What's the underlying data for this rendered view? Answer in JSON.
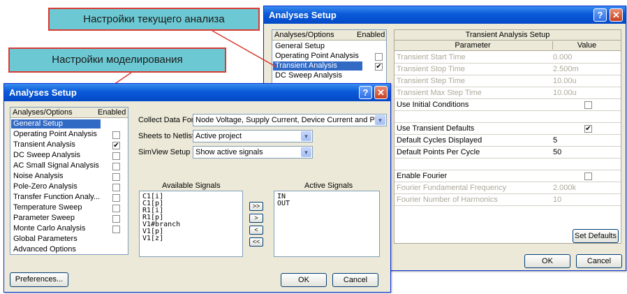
{
  "callouts": {
    "current_analysis": "Настройки текущего анализа",
    "simulation_settings": "Настройки моделирования"
  },
  "dialog_back": {
    "title": "Analyses Setup",
    "list_header": {
      "col1": "Analyses/Options",
      "col2": "Enabled"
    },
    "items": [
      {
        "label": "General Setup"
      },
      {
        "label": "Operating Point Analysis",
        "enabled": ""
      },
      {
        "label": "Transient Analysis",
        "enabled": "✔"
      },
      {
        "label": "DC Sweep Analysis"
      }
    ],
    "grid_title": "Transient Analysis Setup",
    "grid_header": {
      "param": "Parameter",
      "value": "Value"
    },
    "params": [
      {
        "name": "Transient Start Time",
        "value": "0.000"
      },
      {
        "name": "Transient Stop Time",
        "value": "2.500m"
      },
      {
        "name": "Transient Step Time",
        "value": "10.00u"
      },
      {
        "name": "Transient Max Step Time",
        "value": "10.00u"
      },
      {
        "name": "Use Initial Conditions",
        "value": ""
      },
      {
        "name": "",
        "value": ""
      },
      {
        "name": "Use Transient Defaults",
        "value": "✔"
      },
      {
        "name": "Default Cycles Displayed",
        "value": "5"
      },
      {
        "name": "Default Points Per Cycle",
        "value": "50"
      },
      {
        "name": "",
        "value": ""
      },
      {
        "name": "Enable Fourier",
        "value": ""
      },
      {
        "name": "Fourier Fundamental Frequency",
        "value": "2.000k"
      },
      {
        "name": "Fourier Number of Harmonics",
        "value": "10"
      }
    ],
    "set_defaults": "Set Defaults",
    "ok": "OK",
    "cancel": "Cancel"
  },
  "dialog_front": {
    "title": "Analyses Setup",
    "list_header": {
      "col1": "Analyses/Options",
      "col2": "Enabled"
    },
    "items": [
      {
        "label": "General Setup"
      },
      {
        "label": "Operating Point Analysis",
        "enabled": ""
      },
      {
        "label": "Transient Analysis",
        "enabled": "✔"
      },
      {
        "label": "DC Sweep Analysis",
        "enabled": ""
      },
      {
        "label": "AC Small Signal Analysis",
        "enabled": ""
      },
      {
        "label": "Noise Analysis",
        "enabled": ""
      },
      {
        "label": "Pole-Zero Analysis",
        "enabled": ""
      },
      {
        "label": "Transfer Function Analy...",
        "enabled": ""
      },
      {
        "label": "Temperature Sweep",
        "enabled": ""
      },
      {
        "label": "Parameter Sweep",
        "enabled": ""
      },
      {
        "label": "Monte Carlo Analysis",
        "enabled": ""
      },
      {
        "label": "Global Parameters"
      },
      {
        "label": "Advanced Options"
      }
    ],
    "collect_label": "Collect Data For",
    "collect_value": "Node Voltage, Supply Current, Device Current and Po",
    "sheets_label": "Sheets to Netlist",
    "sheets_value": "Active project",
    "simview_label": "SimView Setup",
    "simview_value": "Show active signals",
    "available_title": "Available Signals",
    "available": [
      "C1[i]",
      "C1[p]",
      "R1[i]",
      "R1[p]",
      "V1#branch",
      "V1[p]",
      "V1[z]"
    ],
    "active_title": "Active Signals",
    "active": [
      "IN",
      "OUT"
    ],
    "move_buttons": [
      ">>",
      ">",
      "<",
      "<<"
    ],
    "preferences": "Preferences...",
    "ok": "OK",
    "cancel": "Cancel"
  }
}
